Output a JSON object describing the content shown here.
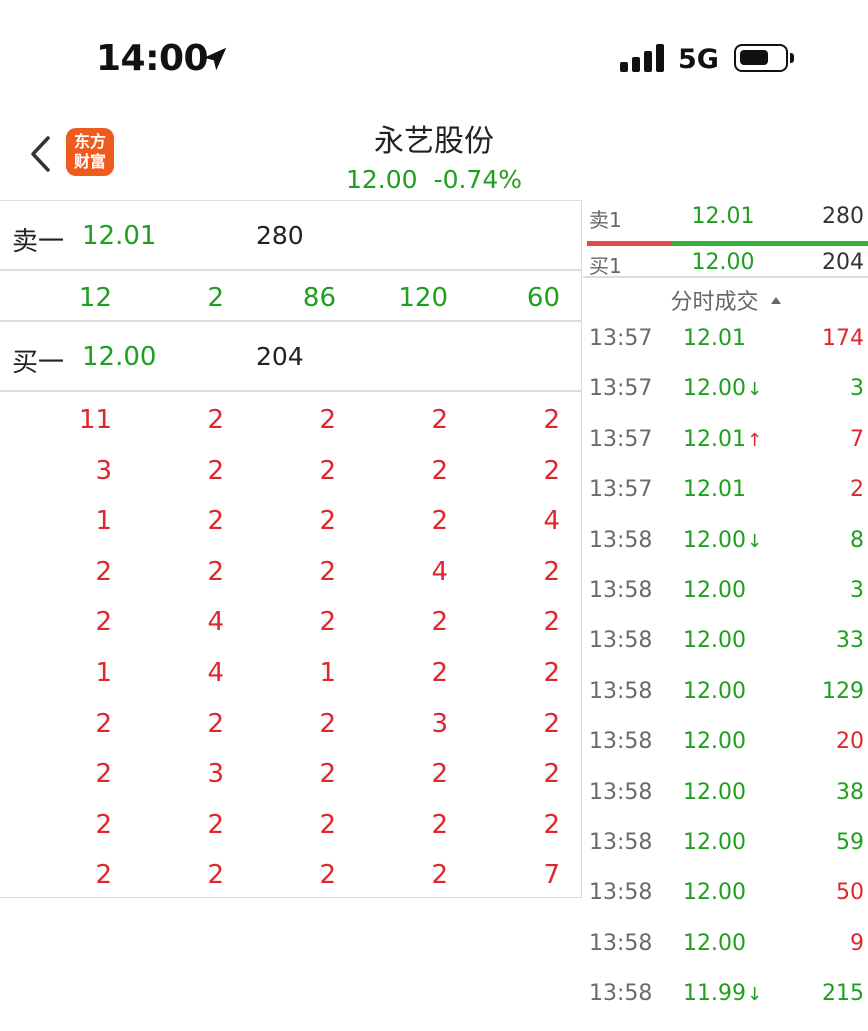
{
  "status_bar": {
    "time": "14:00",
    "network": "5G",
    "icons": [
      "location-arrow-icon",
      "signal-bars-icon",
      "battery-icon"
    ]
  },
  "header": {
    "back_icon": "chevron-left-icon",
    "logo_text": [
      "东方",
      "财富"
    ],
    "title": "永艺股份",
    "price": "12.00",
    "change": "-0.74%"
  },
  "colors": {
    "up": "#e0262d",
    "down": "#1ea01e",
    "logo": "#ef5a1f"
  },
  "left_panel": {
    "sell1": {
      "label": "卖一",
      "price": "12.01",
      "volume": "280"
    },
    "sell1_queue": [
      "12",
      "2",
      "86",
      "120",
      "60"
    ],
    "buy1": {
      "label": "买一",
      "price": "12.00",
      "volume": "204"
    },
    "buy1_queue": [
      [
        "11",
        "2",
        "2",
        "2",
        "2"
      ],
      [
        "3",
        "2",
        "2",
        "2",
        "2"
      ],
      [
        "1",
        "2",
        "2",
        "2",
        "4"
      ],
      [
        "2",
        "2",
        "2",
        "4",
        "2"
      ],
      [
        "2",
        "4",
        "2",
        "2",
        "2"
      ],
      [
        "1",
        "4",
        "1",
        "2",
        "2"
      ],
      [
        "2",
        "2",
        "2",
        "3",
        "2"
      ],
      [
        "2",
        "3",
        "2",
        "2",
        "2"
      ],
      [
        "2",
        "2",
        "2",
        "2",
        "2"
      ],
      [
        "2",
        "2",
        "2",
        "2",
        "7"
      ]
    ]
  },
  "right_panel": {
    "sell1": {
      "label": "卖1",
      "price": "12.01",
      "volume": "280"
    },
    "buy1": {
      "label": "买1",
      "price": "12.00",
      "volume": "204"
    },
    "ratio_bar": {
      "sell_fraction": 0.3
    },
    "ticks_header": "分时成交",
    "ticks": [
      {
        "time": "13:57",
        "price": "12.01",
        "arrow": "",
        "volume": "174",
        "price_color": "down",
        "vol_color": "up"
      },
      {
        "time": "13:57",
        "price": "12.00",
        "arrow": "↓",
        "volume": "3",
        "price_color": "down",
        "vol_color": "down"
      },
      {
        "time": "13:57",
        "price": "12.01",
        "arrow": "↑",
        "volume": "7",
        "price_color": "down",
        "vol_color": "up"
      },
      {
        "time": "13:57",
        "price": "12.01",
        "arrow": "",
        "volume": "2",
        "price_color": "down",
        "vol_color": "up"
      },
      {
        "time": "13:58",
        "price": "12.00",
        "arrow": "↓",
        "volume": "8",
        "price_color": "down",
        "vol_color": "down"
      },
      {
        "time": "13:58",
        "price": "12.00",
        "arrow": "",
        "volume": "3",
        "price_color": "down",
        "vol_color": "down"
      },
      {
        "time": "13:58",
        "price": "12.00",
        "arrow": "",
        "volume": "33",
        "price_color": "down",
        "vol_color": "down"
      },
      {
        "time": "13:58",
        "price": "12.00",
        "arrow": "",
        "volume": "129",
        "price_color": "down",
        "vol_color": "down"
      },
      {
        "time": "13:58",
        "price": "12.00",
        "arrow": "",
        "volume": "20",
        "price_color": "down",
        "vol_color": "up"
      },
      {
        "time": "13:58",
        "price": "12.00",
        "arrow": "",
        "volume": "38",
        "price_color": "down",
        "vol_color": "down"
      },
      {
        "time": "13:58",
        "price": "12.00",
        "arrow": "",
        "volume": "59",
        "price_color": "down",
        "vol_color": "down"
      },
      {
        "time": "13:58",
        "price": "12.00",
        "arrow": "",
        "volume": "50",
        "price_color": "down",
        "vol_color": "up"
      },
      {
        "time": "13:58",
        "price": "12.00",
        "arrow": "",
        "volume": "9",
        "price_color": "down",
        "vol_color": "up"
      },
      {
        "time": "13:58",
        "price": "11.99",
        "arrow": "↓",
        "volume": "215",
        "price_color": "down",
        "vol_color": "down"
      }
    ]
  }
}
